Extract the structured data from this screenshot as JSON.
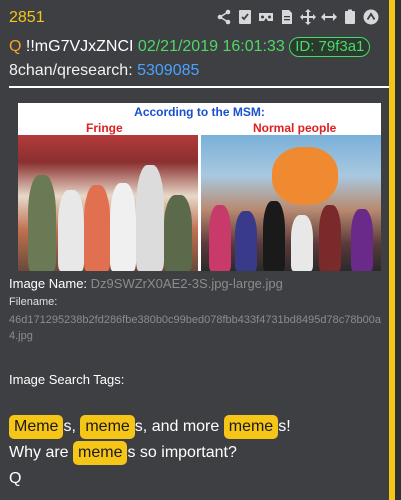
{
  "post": {
    "number": "2851",
    "author_mark": "Q",
    "tripcode": "!!mG7VJxZNCI",
    "timestamp": "02/21/2019 16:01:33",
    "id_badge": "ID: 79f3a1",
    "board": "8chan/qresearch:",
    "thread_number": "5309085"
  },
  "toolbar": {
    "icons": [
      "share-icon",
      "checklist-icon",
      "vr-icon",
      "document-icon",
      "move-icon",
      "expand-horizontal-icon",
      "clipboard-icon",
      "up-arrow-circle-icon"
    ]
  },
  "image": {
    "title": "According to the MSM:",
    "left_label": "Fringe",
    "right_label": "Normal people"
  },
  "meta": {
    "image_name_label": "Image Name:",
    "image_name_value": "Dz9SWZrX0AE2-3S.jpg-large.jpg",
    "filename_label": "Filename:",
    "filename_value": "46d171295238b2fd286fbe380b0c99bed078fbb433f4731bd8495d78c78b00a4.jpg",
    "tags_label": "Image Search Tags:"
  },
  "message": {
    "w1": "Meme",
    "t1": "s, ",
    "w2": "meme",
    "t2": "s, and more ",
    "w3": "meme",
    "t3": "s!",
    "t4": "Why are ",
    "w4": "meme",
    "t5": "s so important?",
    "sig": "Q"
  },
  "colors": {
    "accent": "#f5c518",
    "timestamp": "#4cd964",
    "link": "#4aa3ff"
  }
}
